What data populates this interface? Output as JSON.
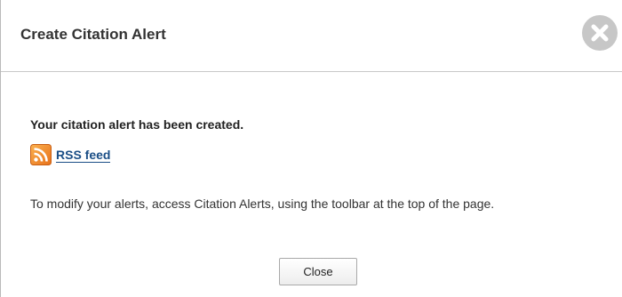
{
  "dialog": {
    "title": "Create Citation Alert",
    "close_icon": "close-x-circle-icon",
    "confirmation": "Your citation alert has been created.",
    "rss": {
      "icon": "rss-feed-icon",
      "label": "RSS feed"
    },
    "info_text": "To modify your alerts, access Citation Alerts, using the toolbar at the top of the page.",
    "close_button": "Close"
  },
  "colors": {
    "link": "#1a4e86",
    "rss_orange": "#f68a1f",
    "close_circle": "#c7c7c7"
  }
}
